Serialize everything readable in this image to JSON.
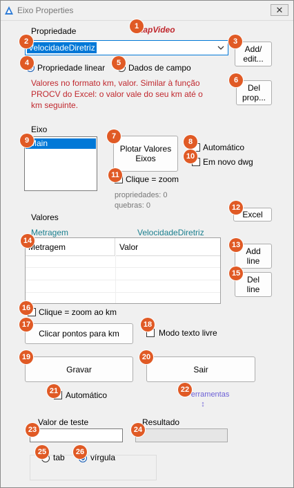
{
  "window": {
    "title": "Eixo Properties",
    "close_glyph": "✕"
  },
  "lapvideo": "LapVideo",
  "propriedade": {
    "label": "Propriedade",
    "select_value": "VelocidadeDiretriz",
    "add_edit_button": "Add/\nedit...",
    "radio_linear": "Propriedade linear",
    "radio_linear_selected": true,
    "radio_campo": "Dados de campo",
    "radio_campo_selected": false,
    "description": "Valores no formato km, valor. Similar à função PROCV do Excel: o valor vale do seu km até o km seguinte.",
    "del_prop_button": "Del\nprop..."
  },
  "eixo": {
    "label": "Eixo",
    "items": [
      "Main"
    ],
    "selected": "Main",
    "plot_button": "Plotar Valores\nEixos",
    "automatico": "Automático",
    "automatico_checked": false,
    "novo_dwg": "Em novo dwg",
    "novo_dwg_checked": false,
    "clique_zoom": "Clique = zoom",
    "clique_zoom_checked": false,
    "propriedades_count": "propriedades: 0",
    "quebras_count": "quebras: 0"
  },
  "valores": {
    "label": "Valores",
    "excel_button": "Excel",
    "col_caption_left": "Metragem",
    "col_caption_right": "VelocidadeDiretriz",
    "table_headers": [
      "Metragem",
      "Valor"
    ],
    "rows": [],
    "add_line_button": "Add\nline",
    "del_line_button": "Del\nline",
    "clique_zoom_km": "Clique = zoom ao km",
    "clique_zoom_km_checked": false,
    "clicar_pontos_button": "Clicar pontos para km",
    "modo_texto_livre": "Modo texto livre",
    "modo_texto_livre_checked": false
  },
  "actions": {
    "gravar_button": "Gravar",
    "sair_button": "Sair",
    "automatico": "Automático",
    "automatico_checked": false,
    "ferramentas_link": "Ferramentas ↕"
  },
  "teste": {
    "valor_label": "Valor de teste",
    "valor_value": "",
    "resultado_label": "Resultado",
    "resultado_value": "",
    "radio_tab": "tab",
    "radio_tab_selected": false,
    "radio_virgula": "vírgula",
    "radio_virgula_selected": true
  },
  "badges": [
    "1",
    "2",
    "3",
    "4",
    "5",
    "6",
    "7",
    "8",
    "9",
    "10",
    "11",
    "12",
    "13",
    "14",
    "15",
    "16",
    "17",
    "18",
    "19",
    "20",
    "21",
    "22",
    "23",
    "24",
    "25",
    "26"
  ],
  "colors": {
    "badge": "#e05a25",
    "red_text": "#c0282e",
    "teal_text": "#1a7f8e",
    "link": "#6b5fd6",
    "selection": "#0078d7"
  }
}
